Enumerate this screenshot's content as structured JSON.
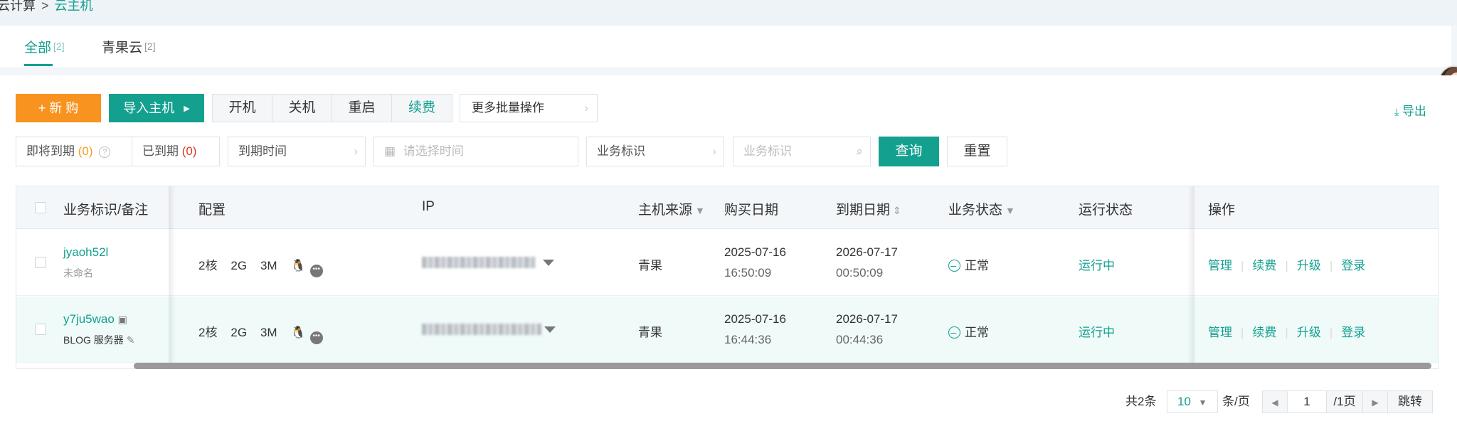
{
  "breadcrumb": {
    "parent": "云计算",
    "separator": ">",
    "current": "云主机"
  },
  "tabs": [
    {
      "label": "全部",
      "count": "[2]",
      "active": true
    },
    {
      "label": "青果云",
      "count": "[2]",
      "active": false
    }
  ],
  "toolbar": {
    "new_label": "+ 新 购",
    "import_label": "导入主机",
    "power_buttons": [
      "开机",
      "关机",
      "重启",
      "续费"
    ],
    "more_label": "更多批量操作",
    "export_label": "导出"
  },
  "filters": {
    "expiring_label": "即将到期",
    "expiring_count": "(0)",
    "expired_label": "已到期",
    "expired_count": "(0)",
    "expiry_time_label": "到期时间",
    "date_placeholder": "请选择时间",
    "tag_select_label": "业务标识",
    "tag_placeholder": "业务标识",
    "query_label": "查询",
    "reset_label": "重置"
  },
  "table": {
    "headers": {
      "tag": "业务标识/备注",
      "config": "配置",
      "ip": "IP",
      "source": "主机来源",
      "purchase": "购买日期",
      "expiry": "到期日期",
      "biz_status": "业务状态",
      "run_status": "运行状态",
      "ops": "操作"
    },
    "rows": [
      {
        "id": "jyaoh52l",
        "note": "未命名",
        "cpu": "2核",
        "ram": "2G",
        "bw": "3M",
        "source": "青果",
        "purchase_date": "2025-07-16",
        "purchase_time": "16:50:09",
        "expiry_date": "2026-07-17",
        "expiry_time": "00:50:09",
        "biz_status": "正常",
        "run_status": "运行中",
        "ops": [
          "管理",
          "续费",
          "升级",
          "登录"
        ]
      },
      {
        "id": "y7ju5wao",
        "note": "BLOG 服务器",
        "cpu": "2核",
        "ram": "2G",
        "bw": "3M",
        "source": "青果",
        "purchase_date": "2025-07-16",
        "purchase_time": "16:44:36",
        "expiry_date": "2026-07-17",
        "expiry_time": "00:44:36",
        "biz_status": "正常",
        "run_status": "运行中",
        "ops": [
          "管理",
          "续费",
          "升级",
          "登录"
        ]
      }
    ]
  },
  "pagination": {
    "total": "共2条",
    "page_size": "10",
    "per_page_label": "条/页",
    "current_page": "1",
    "total_pages": "/1页",
    "jump_label": "跳转"
  },
  "colors": {
    "accent": "#13a08f",
    "orange": "#f7931e",
    "danger": "#d9362b"
  }
}
